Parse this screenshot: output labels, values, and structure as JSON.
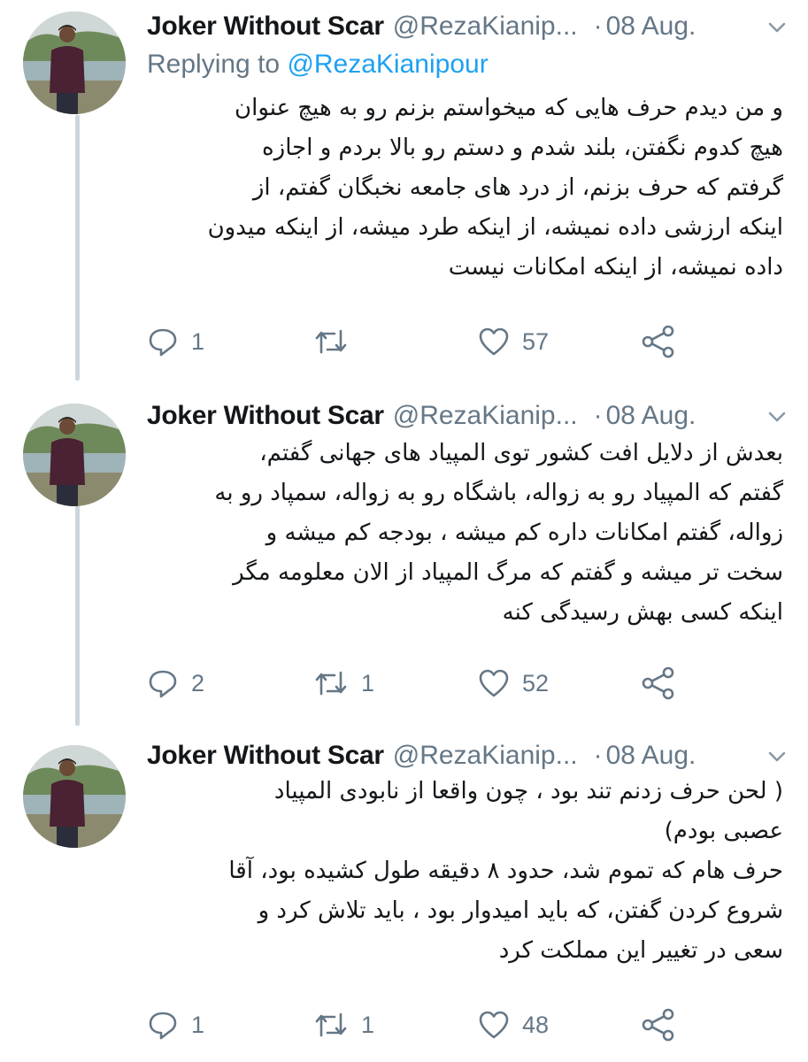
{
  "tweets": [
    {
      "author_name": "Joker Without Scar",
      "author_handle": "@RezaKianip...",
      "separator": "·",
      "date": "08 Aug.",
      "replying_prefix": "Replying to",
      "replying_to": "@RezaKianipour",
      "lines": [
        "و من دیدم حرف هایی که میخواستم بزنم رو به هیچ عنوان",
        "هیچ کدوم نگفتن، بلند شدم و دستم رو بالا بردم و اجازه",
        "گرفتم که حرف بزنم، از درد های جامعه نخبگان گفتم، از",
        "اینکه ارزشی داده نمیشه، از اینکه طرد میشه، از اینکه میدون",
        "داده نمیشه، از اینکه امکانات نیست"
      ],
      "replies": "1",
      "retweets": "",
      "likes": "57"
    },
    {
      "author_name": "Joker Without Scar",
      "author_handle": "@RezaKianip...",
      "separator": "·",
      "date": "08 Aug.",
      "lines": [
        "بعدش از دلایل افت کشور توی المپیاد های جهانی گفتم،",
        "گفتم که المپیاد رو به زواله، باشگاه رو به زواله، سمپاد رو به",
        "زواله، گفتم امکانات داره کم میشه ، بودجه کم میشه و",
        "سخت تر میشه و گفتم که مرگ المپیاد از الان معلومه مگر",
        "اینکه کسی بهش رسیدگی کنه"
      ],
      "replies": "2",
      "retweets": "1",
      "likes": "52"
    },
    {
      "author_name": "Joker Without Scar",
      "author_handle": "@RezaKianip...",
      "separator": "·",
      "date": "08 Aug.",
      "lines": [
        "( لحن حرف زدنم تند بود ، چون واقعا از نابودی المپیاد",
        "عصبی بودم)",
        "حرف هام که تموم شد، حدود ۸ دقیقه طول کشیده بود، آقا",
        "شروع کردن گفتن، که باید امیدوار بود ، باید تلاش کرد و",
        "سعی در تغییر این مملکت کرد"
      ],
      "replies": "1",
      "retweets": "1",
      "likes": "48"
    }
  ],
  "icons": {
    "reply": "reply-icon",
    "retweet": "retweet-icon",
    "like": "heart-icon",
    "share": "share-icon",
    "menu": "chevron-down-icon"
  },
  "colors": {
    "text": "#14171a",
    "secondary": "#657786",
    "link": "#1da1f2",
    "thread_line": "#ccd6dd"
  }
}
